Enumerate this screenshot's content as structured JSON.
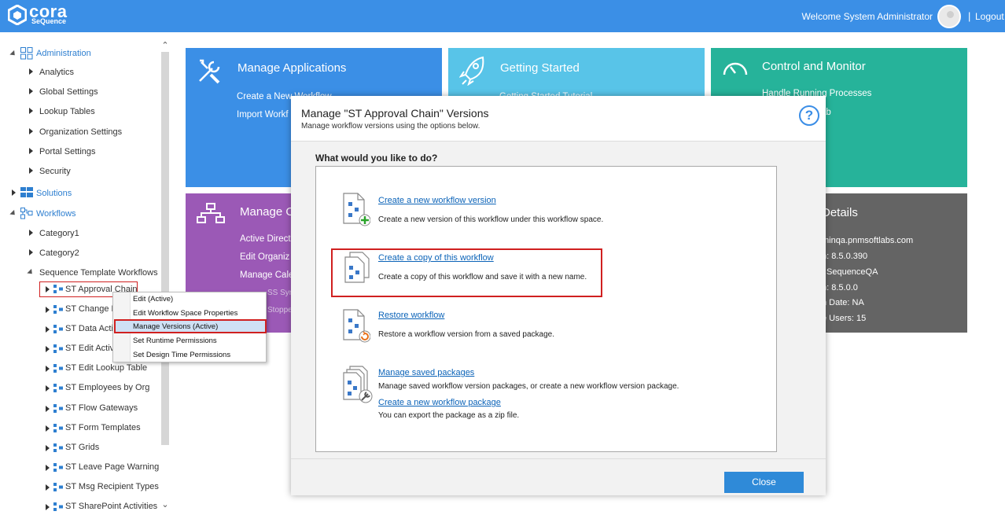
{
  "header": {
    "logo_text": "cora",
    "logo_sub": "SeQuence",
    "welcome": "Welcome System Administrator",
    "separator": "|",
    "logout": "Logout"
  },
  "sidebar": {
    "administration": {
      "label": "Administration",
      "items": [
        "Analytics",
        "Global Settings",
        "Lookup Tables",
        "Organization Settings",
        "Portal Settings",
        "Security"
      ]
    },
    "solutions": {
      "label": "Solutions"
    },
    "workflows": {
      "label": "Workflows",
      "items": [
        "Category1",
        "Category2",
        "Sequence Template Workflows"
      ],
      "templates": [
        "ST Approval Chain",
        "ST Change R",
        "ST Data Acti",
        "ST Edit Activi",
        "ST Edit Lookup Table",
        "ST Employees by Org",
        "ST Flow Gateways",
        "ST Form Templates",
        "ST Grids",
        "ST Leave Page Warning",
        "ST Msg Recipient Types",
        "ST SharePoint Activities"
      ]
    }
  },
  "tiles": {
    "manage_applications": {
      "title": "Manage Applications",
      "links": [
        "Create a New Workflow",
        "Import Workf"
      ],
      "color": "#3b8fe6"
    },
    "getting_started": {
      "title": "Getting Started",
      "links": [
        "Getting Started Tutorial"
      ],
      "color": "#58c4e8"
    },
    "control_monitor": {
      "title": "Control and Monitor",
      "links": [
        "Handle Running Processes",
        "ab"
      ],
      "color": "#26b39a"
    },
    "manage_org": {
      "title": "Manage O",
      "links": [
        "Active Direct",
        "Edit Organiz",
        "Manage Cale",
        "SS Sync",
        "Stopped"
      ],
      "color": "#9b59b6"
    },
    "details": {
      "title": "Details",
      "lines": [
        "minqa.pnmsoftlabs.com",
        "n: 8.5.0.390",
        "SequenceQA",
        "n: 8.5.0.0",
        "n Date: NA",
        "e Users: 15"
      ],
      "color": "#646464"
    }
  },
  "context_menu": {
    "items": [
      "Edit (Active)",
      "Edit Workflow Space Properties",
      "Manage Versions (Active)",
      "Set Runtime Permissions",
      "Set Design Time Permissions"
    ]
  },
  "modal": {
    "title": "Manage \"ST Approval Chain\" Versions",
    "subtitle": "Manage workflow versions using the options below.",
    "help": "?",
    "question": "What would you like to do?",
    "options": [
      {
        "link": "Create a new workflow version",
        "desc": "Create a new version of this workflow under this workflow space."
      },
      {
        "link": "Create a copy of this workflow",
        "desc": "Create a copy of this workflow and save it with a new name."
      },
      {
        "link": "Restore workflow",
        "desc": "Restore a workflow version from a saved package."
      },
      {
        "link": "Manage saved packages",
        "desc": "Manage saved workflow version packages, or create a new workflow version package.",
        "link2": "Create a new workflow package",
        "desc2": "You can export the package as a zip file."
      }
    ],
    "close_label": "Close"
  }
}
